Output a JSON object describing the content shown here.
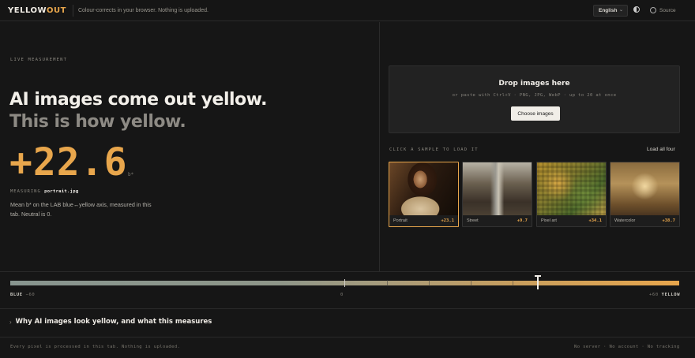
{
  "header": {
    "logo_main": "YELLOW",
    "logo_accent": "OUT",
    "tagline": "Colour-corrects in your browser. Nothing is uploaded.",
    "language": "English",
    "source_label": "Source"
  },
  "hero": {
    "eyebrow": "LIVE MEASUREMENT",
    "headline_1": "AI images come out yellow.",
    "headline_2": "This is how yellow.",
    "value": "+22.6",
    "unit": "b*",
    "measuring_label": "MEASURING",
    "measuring_file": "portrait.jpg",
    "description": "Mean b* on the LAB blue↔yellow axis, measured in this tab. Neutral is 0."
  },
  "dropzone": {
    "title": "Drop images here",
    "subtitle": "or paste with Ctrl+V · PNG, JPG, WebP · up to 20 at once",
    "button": "Choose images"
  },
  "samples": {
    "label": "CLICK A SAMPLE TO LOAD IT",
    "load_all": "Load all four",
    "items": [
      {
        "name": "Portrait",
        "value": "+23.1",
        "selected": true
      },
      {
        "name": "Street",
        "value": "+9.7",
        "selected": false
      },
      {
        "name": "Pixel art",
        "value": "+34.1",
        "selected": false
      },
      {
        "name": "Watercolor",
        "value": "+38.7",
        "selected": false
      }
    ]
  },
  "scale": {
    "min_label_prefix": "BLUE",
    "min_value": "−60",
    "mid_value": "0",
    "max_value": "+60",
    "max_label_suffix": "YELLOW",
    "current": 22.6,
    "min": -60,
    "max": 60
  },
  "why": {
    "title": "Why AI images look yellow, and what this measures"
  },
  "footer": {
    "left": "Every pixel is processed in this tab. Nothing is uploaded.",
    "right": "No server · No account · No tracking"
  }
}
